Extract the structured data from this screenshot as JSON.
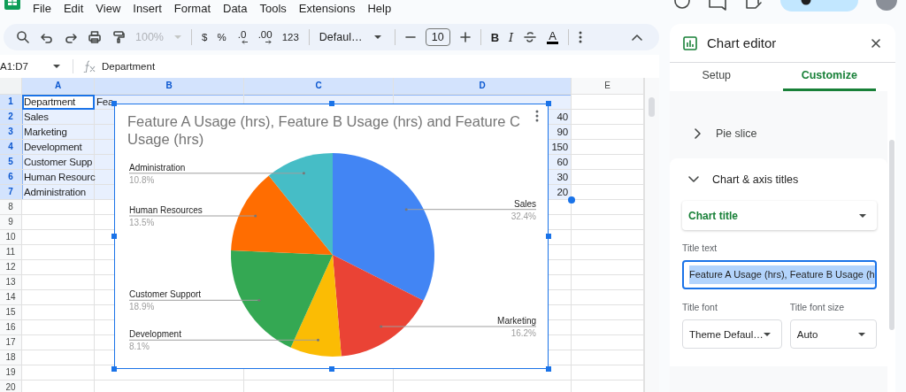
{
  "menu_bar": {
    "items": [
      "File",
      "Edit",
      "View",
      "Insert",
      "Format",
      "Data",
      "Tools",
      "Extensions",
      "Help"
    ]
  },
  "toolbar": {
    "zoom": {
      "text": "100%",
      "disabled": true
    },
    "number_formats": [
      {
        "kind": "text",
        "label": "$"
      },
      {
        "kind": "text",
        "label": "%"
      },
      {
        "kind": "decimal_decrease",
        "label": ".0"
      },
      {
        "kind": "decimal_increase",
        "label": ".00"
      },
      {
        "kind": "text",
        "label": "123"
      }
    ],
    "font": "Defaul…",
    "font_size": "10",
    "text_styles": [
      {
        "kind": "bold",
        "label": "B"
      },
      {
        "kind": "italic",
        "label": "I"
      }
    ],
    "text_color": "A"
  },
  "formula_bar": {
    "name_box": "A1:D7",
    "formula": "Department"
  },
  "grid": {
    "columns": [
      {
        "label": "A",
        "selected": true
      },
      {
        "label": "B",
        "selected": true
      },
      {
        "label": "C",
        "selected": true
      },
      {
        "label": "D",
        "selected": true
      },
      {
        "label": "E",
        "selected": false
      }
    ],
    "rows": [
      {
        "number": "1",
        "selected": true,
        "a": {
          "text": "Department",
          "active": true
        },
        "b": {
          "text": "Fea"
        }
      },
      {
        "number": "2",
        "selected": true,
        "a": {
          "text": "Sales"
        },
        "d": {
          "text": "40"
        }
      },
      {
        "number": "3",
        "selected": true,
        "a": {
          "text": "Marketing"
        },
        "d": {
          "text": "90"
        }
      },
      {
        "number": "4",
        "selected": true,
        "a": {
          "text": "Development"
        },
        "d": {
          "text": "150"
        }
      },
      {
        "number": "5",
        "selected": true,
        "a": {
          "text": "Customer Supp"
        },
        "d": {
          "text": "60"
        }
      },
      {
        "number": "6",
        "selected": true,
        "a": {
          "text": "Human Resourc"
        },
        "d": {
          "text": "30"
        }
      },
      {
        "number": "7",
        "selected": true,
        "a": {
          "text": "Administration"
        },
        "d": {
          "text": "20"
        }
      },
      {
        "number": "8",
        "selected": false
      },
      {
        "number": "9",
        "selected": false
      },
      {
        "number": "10",
        "selected": false
      },
      {
        "number": "11",
        "selected": false
      },
      {
        "number": "12",
        "selected": false
      },
      {
        "number": "13",
        "selected": false
      },
      {
        "number": "14",
        "selected": false
      },
      {
        "number": "15",
        "selected": false
      },
      {
        "number": "16",
        "selected": false
      },
      {
        "number": "17",
        "selected": false
      },
      {
        "number": "18",
        "selected": false
      },
      {
        "number": "19",
        "selected": false
      },
      {
        "number": "20",
        "selected": false
      }
    ]
  },
  "chart": {
    "selected": true,
    "chart_data": {
      "type": "pie",
      "title": "Feature A Usage (hrs), Feature B Usage (hrs) and Feature C Usage (hrs)",
      "categories": [
        "Sales",
        "Marketing",
        "Development",
        "Customer Support",
        "Human Resources",
        "Administration"
      ],
      "values": [
        32.4,
        16.2,
        8.1,
        18.9,
        13.5,
        10.8
      ],
      "value_labels": [
        "32.4%",
        "16.2%",
        "8.1%",
        "18.9%",
        "13.5%",
        "10.8%"
      ],
      "colors": [
        "#4285f4",
        "#ea4335",
        "#fbbc04",
        "#34a853",
        "#ff6d01",
        "#46bdc6"
      ]
    }
  },
  "chart_editor": {
    "title": "Chart editor",
    "tabs": [
      {
        "label": "Setup",
        "selected": false
      },
      {
        "label": "Customize",
        "selected": true
      }
    ],
    "sections": [
      {
        "label": "Pie slice",
        "expanded": false
      },
      {
        "label": "Chart & axis titles",
        "expanded": true,
        "dropdown": "Chart title",
        "title_text": {
          "label": "Title text",
          "value": "Feature A Usage (hrs), Feature B Usage (h",
          "highlighted": true
        },
        "title_font": {
          "label": "Title font",
          "value": "Theme Defaul…"
        },
        "title_font_size": {
          "label": "Title font size",
          "value": "Auto"
        }
      }
    ]
  }
}
